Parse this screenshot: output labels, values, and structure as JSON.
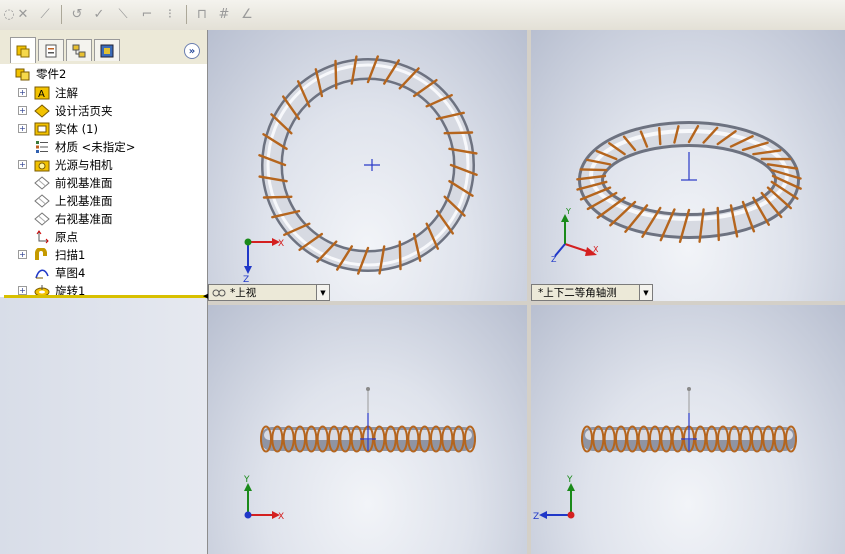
{
  "toolbar": {
    "icons": [
      "sketch-tool-icon",
      "trim-icon",
      "extend-icon",
      "offset-icon",
      "mirror-icon",
      "convert-icon",
      "line-icon",
      "corner-icon",
      "construction-icon",
      "grid-icon",
      "table-icon",
      "angle-icon"
    ]
  },
  "panel": {
    "tabs": [
      "featuremanager-tab",
      "propertymanager-tab",
      "configurationmanager-tab",
      "dimxpert-tab"
    ],
    "expand_label": "»",
    "root": "零件2",
    "items": [
      {
        "label": "注解",
        "icon": "annotations-icon",
        "expandable": true
      },
      {
        "label": "设计活页夹",
        "icon": "design-binder-icon",
        "expandable": true
      },
      {
        "label": "实体 (1)",
        "icon": "solid-bodies-icon",
        "expandable": true
      },
      {
        "label": "材质 <未指定>",
        "icon": "material-icon",
        "expandable": false
      },
      {
        "label": "光源与相机",
        "icon": "lights-cameras-icon",
        "expandable": true
      },
      {
        "label": "前视基准面",
        "icon": "plane-icon",
        "expandable": false
      },
      {
        "label": "上视基准面",
        "icon": "plane-icon",
        "expandable": false
      },
      {
        "label": "右视基准面",
        "icon": "plane-icon",
        "expandable": false
      },
      {
        "label": "原点",
        "icon": "origin-icon",
        "expandable": false
      },
      {
        "label": "扫描1",
        "icon": "sweep-icon",
        "expandable": true
      },
      {
        "label": "草图4",
        "icon": "sketch-icon",
        "expandable": false
      },
      {
        "label": "旋转1",
        "icon": "revolve-icon",
        "expandable": true
      }
    ]
  },
  "viewports": {
    "top_left": {
      "label": "*上视"
    },
    "top_right": {
      "label": "*上下二等角轴测"
    }
  },
  "colors": {
    "coil": "#b5651d",
    "ring": "#c9ccd6",
    "axis_x": "#d42020",
    "axis_y": "#1a8a1a",
    "axis_z": "#2038c8"
  }
}
